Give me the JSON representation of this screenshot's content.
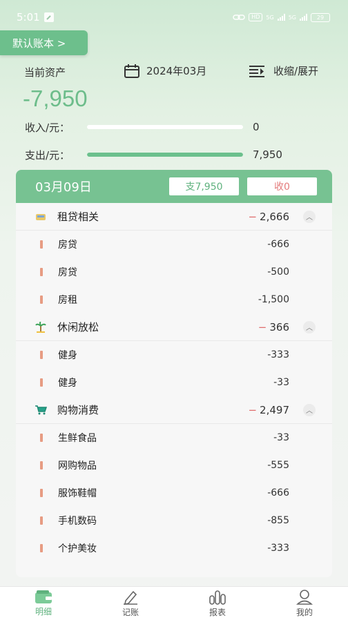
{
  "status_bar": {
    "time": "5:01",
    "net_label": "HD",
    "sig1": "5G",
    "sig2": "5G",
    "battery": "29"
  },
  "header": {
    "book_button": "默认账本 >",
    "asset_label": "当前资产",
    "month": "2024年03月",
    "collapse_label": "收缩/展开",
    "asset_value": "-7,950"
  },
  "summary": {
    "income_label": "收入/元：",
    "income_value": "0",
    "income_fill": 0,
    "expense_label": "支出/元：",
    "expense_value": "7,950",
    "expense_fill": 1
  },
  "day": {
    "date": "03月09日",
    "expense_chip": "支7,950",
    "income_chip": "收0"
  },
  "categories": [
    {
      "name": "租贷相关",
      "amount": "2,666",
      "icon": "house-loan-icon",
      "items": [
        {
          "name": "房贷",
          "amount": "-666"
        },
        {
          "name": "房贷",
          "amount": "-500"
        },
        {
          "name": "房租",
          "amount": "-1,500"
        }
      ]
    },
    {
      "name": "休闲放松",
      "amount": "366",
      "icon": "palm-tree-icon",
      "items": [
        {
          "name": "健身",
          "amount": "-333"
        },
        {
          "name": "健身",
          "amount": "-33"
        }
      ]
    },
    {
      "name": "购物消费",
      "amount": "2,497",
      "icon": "shopping-cart-icon",
      "items": [
        {
          "name": "生鲜食品",
          "amount": "-33"
        },
        {
          "name": "网购物品",
          "amount": "-555"
        },
        {
          "name": "服饰鞋帽",
          "amount": "-666"
        },
        {
          "name": "手机数码",
          "amount": "-855"
        },
        {
          "name": "个护美妆",
          "amount": "-333"
        }
      ]
    }
  ],
  "tabs": [
    {
      "label": "明细",
      "icon": "wallet-icon",
      "active": true
    },
    {
      "label": "记账",
      "icon": "pen-icon",
      "active": false
    },
    {
      "label": "报表",
      "icon": "bar-chart-icon",
      "active": false
    },
    {
      "label": "我的",
      "icon": "user-icon",
      "active": false
    }
  ],
  "colors": {
    "accent": "#6dbd8b",
    "expense_minus": "#e06a6a",
    "item_bar": "#e79c83"
  }
}
